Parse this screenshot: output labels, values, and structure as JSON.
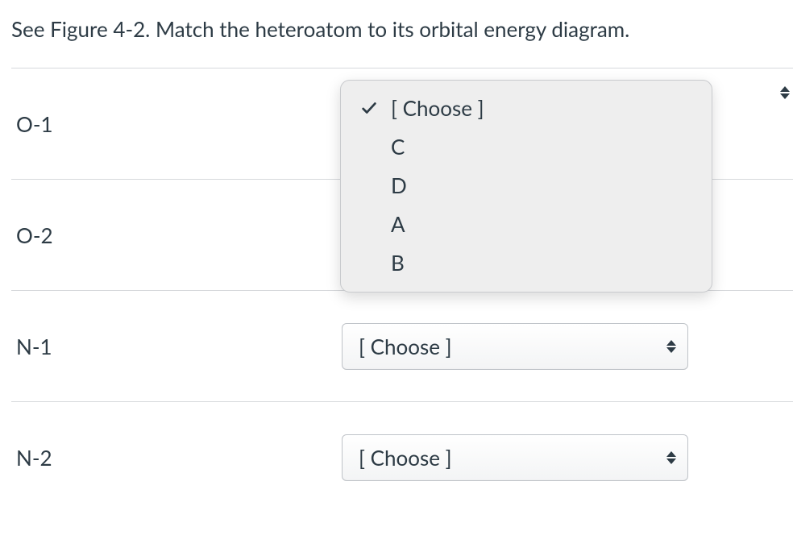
{
  "question": "See Figure 4-2.  Match the heteroatom to its orbital energy diagram.",
  "dropdown_placeholder": "[ Choose ]",
  "rows": [
    {
      "label": "O-1",
      "value": "[ Choose ]",
      "open": true,
      "focused": true
    },
    {
      "label": "O-2",
      "value": "[ Choose ]",
      "open": false,
      "focused": false
    },
    {
      "label": "N-1",
      "value": "[ Choose ]",
      "open": false,
      "focused": false
    },
    {
      "label": "N-2",
      "value": "[ Choose ]",
      "open": false,
      "focused": false
    }
  ],
  "options": [
    {
      "label": "[ Choose ]",
      "selected": true
    },
    {
      "label": "C",
      "selected": false
    },
    {
      "label": "D",
      "selected": false
    },
    {
      "label": "A",
      "selected": false
    },
    {
      "label": "B",
      "selected": false
    }
  ]
}
